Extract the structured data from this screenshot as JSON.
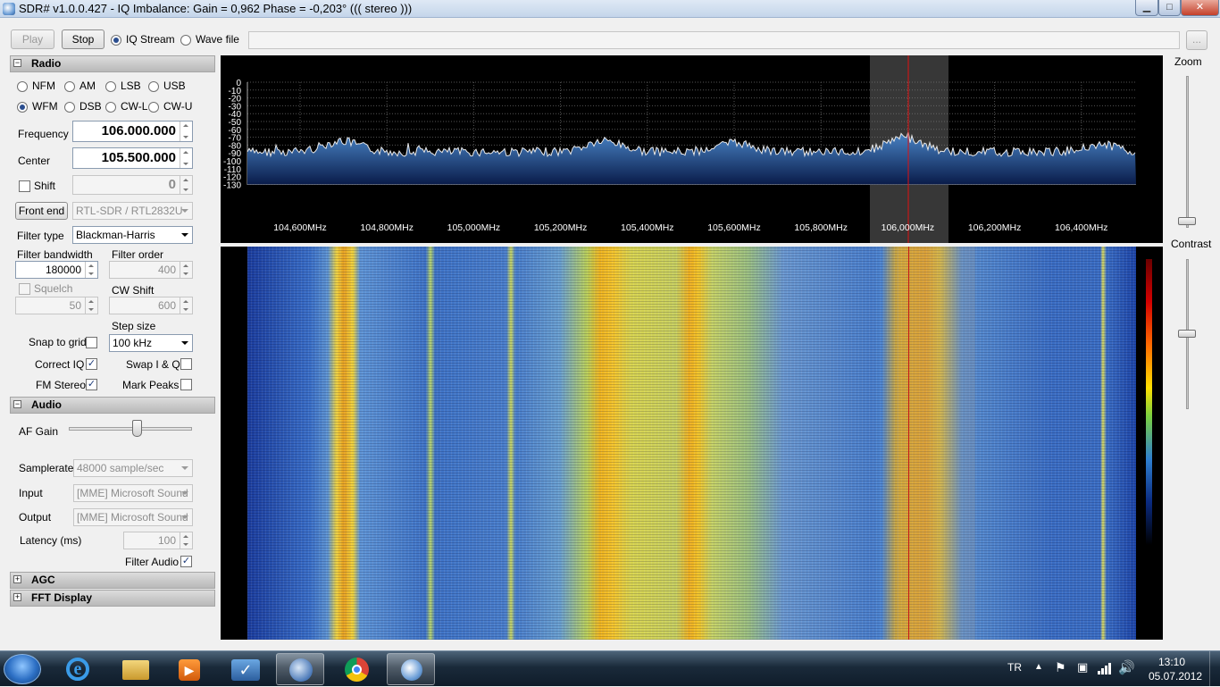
{
  "window": {
    "title": "SDR# v1.0.0.427 - IQ Imbalance: Gain = 0,962 Phase = -0,203° ((( stereo )))",
    "icon": "sdr-app-icon"
  },
  "toolbar": {
    "play_label": "Play",
    "stop_label": "Stop",
    "source_options": [
      "IQ Stream",
      "Wave file"
    ],
    "selected_source": "IQ Stream",
    "browse_label": "..."
  },
  "radio": {
    "section_title": "Radio",
    "modes": [
      "NFM",
      "AM",
      "LSB",
      "USB",
      "WFM",
      "DSB",
      "CW-L",
      "CW-U"
    ],
    "selected_mode": "WFM",
    "frequency_label": "Frequency",
    "frequency_value": "106.000.000",
    "center_label": "Center",
    "center_value": "105.500.000",
    "shift_label": "Shift",
    "shift_value": "0",
    "front_end_label": "Front end",
    "front_end_value": "RTL-SDR / RTL2832U",
    "filter_type_label": "Filter type",
    "filter_type_value": "Blackman-Harris",
    "filter_bandwidth_label": "Filter bandwidth",
    "filter_bandwidth_value": "180000",
    "filter_order_label": "Filter order",
    "filter_order_value": "400",
    "squelch_label": "Squelch",
    "squelch_value": "50",
    "cw_shift_label": "CW Shift",
    "cw_shift_value": "600",
    "step_size_label": "Step size",
    "step_size_value": "100 kHz",
    "snap_to_grid_label": "Snap to grid",
    "correct_iq_label": "Correct IQ",
    "swap_iq_label": "Swap I & Q",
    "fm_stereo_label": "FM Stereo",
    "mark_peaks_label": "Mark Peaks"
  },
  "audio": {
    "section_title": "Audio",
    "af_gain_label": "AF Gain",
    "af_gain_level": 0.6,
    "samplerate_label": "Samplerate",
    "samplerate_value": "48000 sample/sec",
    "input_label": "Input",
    "input_value": "[MME] Microsoft Sound",
    "output_label": "Output",
    "output_value": "[MME] Microsoft Sound",
    "latency_label": "Latency (ms)",
    "latency_value": "100",
    "filter_audio_label": "Filter Audio"
  },
  "agc": {
    "section_title": "AGC"
  },
  "fft_display": {
    "section_title": "FFT Display"
  },
  "spectrum": {
    "y_ticks": [
      "0",
      "-10",
      "-20",
      "-30",
      "-40",
      "-50",
      "-60",
      "-70",
      "-80",
      "-90",
      "-100",
      "-110",
      "-120",
      "-130"
    ],
    "x_ticks": [
      "104,600MHz",
      "104,800MHz",
      "105,000MHz",
      "105,200MHz",
      "105,400MHz",
      "105,600MHz",
      "105,800MHz",
      "106,000MHz",
      "106,200MHz",
      "106,400MHz"
    ]
  },
  "side": {
    "zoom_label": "Zoom",
    "contrast_label": "Contrast"
  },
  "taskbar": {
    "language": "TR",
    "time": "13:10",
    "date": "05.07.2012",
    "apps": [
      "internet-explorer-icon",
      "file-explorer-icon",
      "media-player-icon",
      "tasks-icon",
      "thunderbird-icon",
      "chrome-icon",
      "sdr-sharp-icon"
    ]
  }
}
